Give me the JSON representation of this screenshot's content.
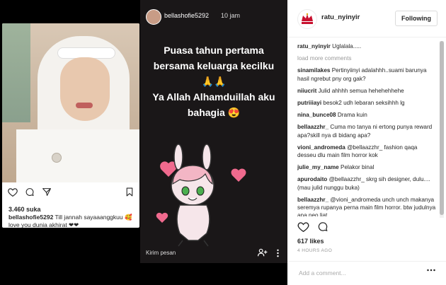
{
  "left_post": {
    "likes": "3.460 suka",
    "caption_user": "bellashofie5292",
    "caption_text": "Till jannah sayaaanggkuu 🥰 love you dunia akhirat ❤❤"
  },
  "story": {
    "username": "bellashofie5292",
    "time": "10 jam",
    "text_lines": [
      "Puasa tahun pertama",
      "bersama keluarga kecilku",
      "🙏🙏",
      "Ya Allah Alhamduillah aku",
      "bahagia 😍"
    ],
    "reply_placeholder": "Kirim pesan"
  },
  "right_panel": {
    "username": "ratu_nyinyir",
    "follow_label": "Following",
    "caption_user": "ratu_nyinyir",
    "caption_text": "Uglalala.....",
    "load_more": "load more comments",
    "comments": [
      {
        "user": "sinamilakes",
        "text": "Pertinyiinyi adalahhh..suami barunya hasil ngrebut pny org gak?"
      },
      {
        "user": "niiucrit",
        "text": "Julid ahhhh semua hehehehhehe"
      },
      {
        "user": "putriiiayi",
        "text": "besok2 udh lebaran seksihhh lg"
      },
      {
        "user": "nina_bunce08",
        "text": "Drama kuin"
      },
      {
        "user": "bellaazzhr_",
        "text": "Cuma mo tanya ni ertong punya reward apa?skill nya di bidang apa?"
      },
      {
        "user": "vioni_andromeda",
        "text": "@bellaazzhr_ fashion qaqa desseu dlu main film horror kok"
      },
      {
        "user": "julie_my_name",
        "text": "Pelakor binal"
      },
      {
        "user": "apurodaito",
        "text": "@bellaazzhr_ skrg sih designer, dulu.... (mau julid nunggu buka)"
      },
      {
        "user": "bellaazzhr_",
        "text": "@vioni_andromeda unch unch makanya seremya rupanya perna main film horror. btw judulnya apa neo liat"
      }
    ],
    "likes": "617 likes",
    "time": "4 HOURS AGO",
    "comment_placeholder": "Add a comment..."
  },
  "colors": {
    "story_bg": "#1a1718",
    "text_dark": "#262626",
    "muted": "#999999",
    "heart_pink": "#f06a8e"
  },
  "icons": [
    "heart-icon",
    "comment-icon",
    "share-icon",
    "bookmark-icon",
    "add-person-icon",
    "more-icon"
  ]
}
